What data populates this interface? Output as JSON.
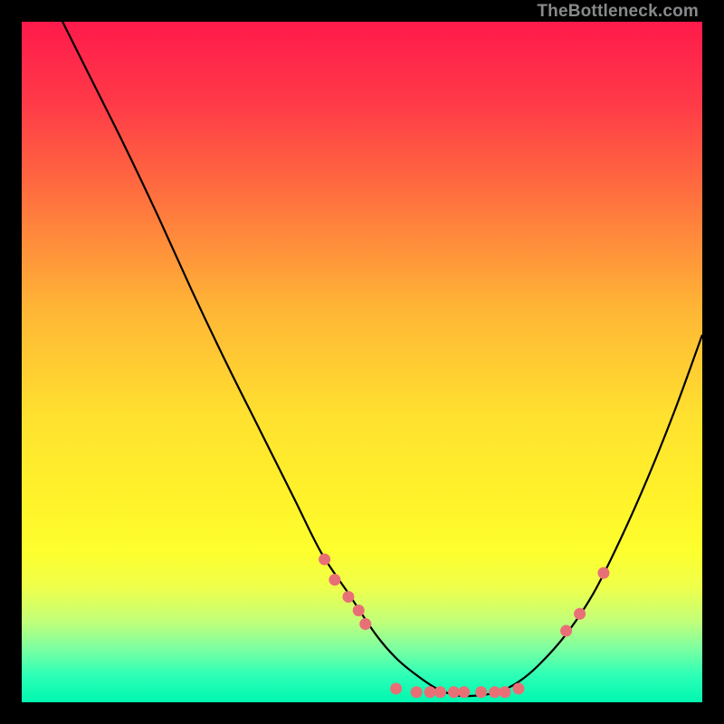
{
  "watermark": "TheBottleneck.com",
  "chart_data": {
    "type": "line",
    "title": "",
    "xlabel": "",
    "ylabel": "",
    "xlim": [
      0,
      100
    ],
    "ylim": [
      0,
      100
    ],
    "series": [
      {
        "name": "curve",
        "x": [
          6,
          10,
          15,
          20,
          25,
          30,
          35,
          40,
          44,
          48,
          52,
          55,
          58,
          61,
          64,
          67,
          70,
          73,
          76,
          80,
          84,
          88,
          92,
          96,
          100
        ],
        "y": [
          100,
          92,
          82,
          71.5,
          60.5,
          50,
          40,
          30,
          22,
          16,
          10,
          6.5,
          4,
          2,
          1,
          1,
          1.5,
          3,
          5.5,
          10,
          16,
          24,
          33,
          43,
          54
        ]
      }
    ],
    "markers": [
      {
        "x": 44.5,
        "y": 21.0
      },
      {
        "x": 46.0,
        "y": 18.0
      },
      {
        "x": 48.0,
        "y": 15.5
      },
      {
        "x": 49.5,
        "y": 13.5
      },
      {
        "x": 50.5,
        "y": 11.5
      },
      {
        "x": 55.0,
        "y": 2.0
      },
      {
        "x": 58.0,
        "y": 1.5
      },
      {
        "x": 60.0,
        "y": 1.5
      },
      {
        "x": 61.5,
        "y": 1.5
      },
      {
        "x": 63.5,
        "y": 1.5
      },
      {
        "x": 65.0,
        "y": 1.5
      },
      {
        "x": 67.5,
        "y": 1.5
      },
      {
        "x": 69.5,
        "y": 1.5
      },
      {
        "x": 71.0,
        "y": 1.5
      },
      {
        "x": 73.0,
        "y": 2.0
      },
      {
        "x": 80.0,
        "y": 10.5
      },
      {
        "x": 82.0,
        "y": 13.0
      },
      {
        "x": 85.5,
        "y": 19.0
      }
    ],
    "marker_color": "#e96f76",
    "line_color": "#000000"
  }
}
